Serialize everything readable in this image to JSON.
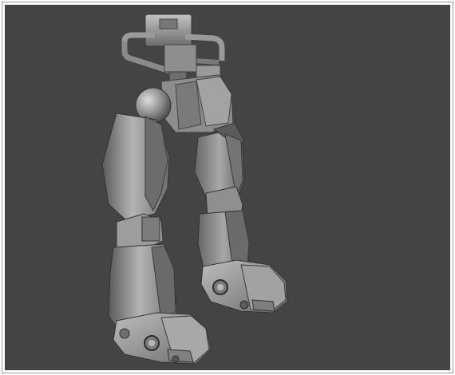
{
  "viewport": {
    "background_color": "#444444",
    "model_base_color": "#8c8c8c",
    "model_highlight_color": "#c8c8c8",
    "model_shadow_color": "#3a3a3a"
  }
}
